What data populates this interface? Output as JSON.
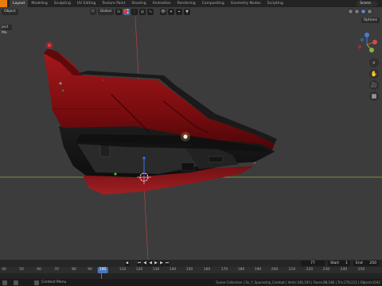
{
  "topbar": {
    "tabs": [
      "Layout",
      "Modeling",
      "Sculpting",
      "UV Editing",
      "Texture Paint",
      "Shading",
      "Animation",
      "Rendering",
      "Compositing",
      "Geometry Nodes",
      "Scripting"
    ],
    "active_tab": "Layout",
    "scene": "Scene"
  },
  "viewport": {
    "mode": "Object",
    "global": "Global",
    "options": "Options",
    "side_label": "ject Mo"
  },
  "colors": {
    "accent": "#4b77be",
    "hull_red": "#8e0f12",
    "grid_x": "#8ab13a",
    "grid_y": "#c94a4a"
  },
  "timeline": {
    "current_frame": "77",
    "start_label": "Start",
    "start": "1",
    "end_label": "End",
    "end": "250",
    "ticks": [
      "40",
      "50",
      "60",
      "70",
      "80",
      "90",
      "100",
      "110",
      "120",
      "130",
      "140",
      "150",
      "160",
      "170",
      "180",
      "190",
      "200",
      "210",
      "220",
      "230",
      "240",
      "250"
    ],
    "cursor": "100"
  },
  "status": {
    "hint": "Context Menu",
    "stats": "Scene Collection | Sv_Y_Spaceship_Combat | Verts:346,193 | Faces:88,186 | Tris:178,212 | Objects:0/42"
  }
}
